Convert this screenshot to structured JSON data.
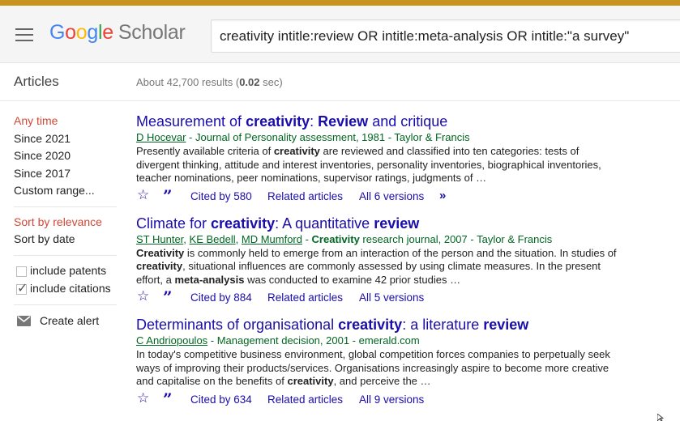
{
  "header": {
    "logo_google_letters": [
      "G",
      "o",
      "o",
      "g",
      "l",
      "e"
    ],
    "logo_scholar": "Scholar",
    "search_value": "creativity intitle:review OR intitle:meta-analysis OR intitle:\"a survey\""
  },
  "subbar": {
    "section_label": "Articles",
    "results_prefix": "About 42,700 results (",
    "results_time": "0.02",
    "results_suffix": " sec)"
  },
  "sidebar": {
    "time_filters": [
      "Any time",
      "Since 2021",
      "Since 2020",
      "Since 2017",
      "Custom range..."
    ],
    "sort_options": [
      "Sort by relevance",
      "Sort by date"
    ],
    "include_patents": "include patents",
    "include_citations": "include citations",
    "create_alert": "Create alert"
  },
  "results": [
    {
      "title": [
        "Measurement of ",
        "creativity",
        ": ",
        "Review",
        " and critique"
      ],
      "authors": [
        "D Hocevar"
      ],
      "meta": " - Journal of Personality assessment, 1981 - Taylor & Francis",
      "snippet": [
        "Presently available criteria of ",
        "creativity",
        " are reviewed and classified into ten categories: tests of divergent thinking, attitude and interest inventories, personality inventories, biographical inventories, teacher nominations, peer nominations, supervisor ratings, judgments of …"
      ],
      "cited_by": "Cited by 580",
      "related": "Related articles",
      "versions": "All 6 versions",
      "more": "»"
    },
    {
      "title": [
        "Climate for ",
        "creativity",
        ": A quantitative ",
        "review",
        ""
      ],
      "authors": [
        "ST Hunter",
        "KE Bedell",
        "MD Mumford"
      ],
      "meta_bold": "Creativity",
      "meta": " research journal, 2007 - Taylor & Francis",
      "snippet": [
        "",
        "Creativity",
        " is commonly held to emerge from an interaction of the person and the situation. In studies of ",
        "creativity",
        ", situational influences are commonly assessed by using climate measures. In the present effort, a ",
        "meta-analysis",
        " was conducted to examine 42 prior studies …"
      ],
      "cited_by": "Cited by 884",
      "related": "Related articles",
      "versions": "All 5 versions"
    },
    {
      "title": [
        "Determinants of organisational ",
        "creativity",
        ": a literature ",
        "review",
        ""
      ],
      "authors": [
        "C Andriopoulos"
      ],
      "meta": " - Management decision, 2001 - emerald.com",
      "snippet": [
        "In today's competitive business environment, global competition forces companies to perpetually seek ways of improving their products/services. Organisations increasingly aspire to become more creative and capitalise on the benefits of ",
        "creativity",
        ", and perceive the …"
      ],
      "cited_by": "Cited by 634",
      "related": "Related articles",
      "versions": "All 9 versions"
    }
  ],
  "colors": {
    "top_accent": "#c8931e",
    "link_blue": "#1a0dab",
    "meta_green": "#006621",
    "active_red": "#d14836"
  }
}
